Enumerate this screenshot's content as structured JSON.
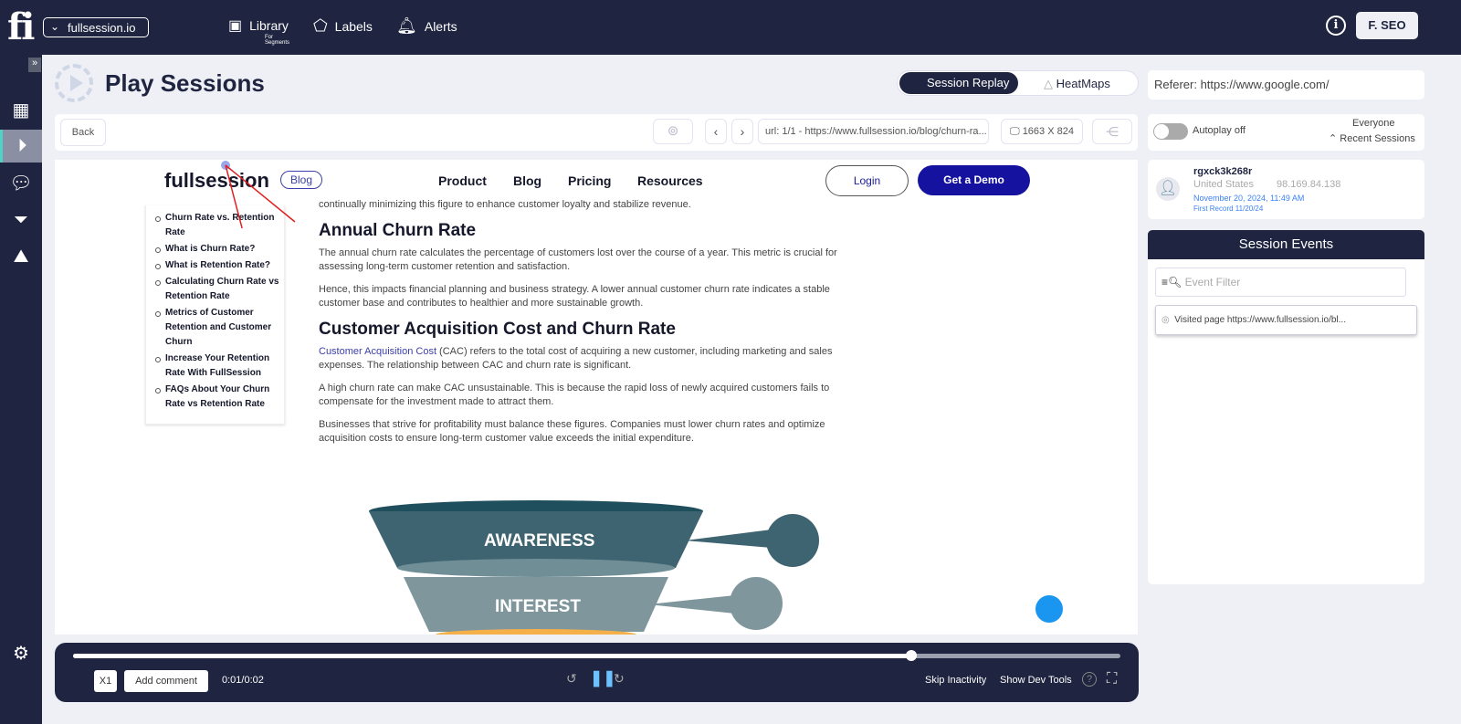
{
  "topbar": {
    "logo": "fi",
    "site": "fullsession.io",
    "nav": [
      {
        "label": "Library",
        "sub": "For Segments"
      },
      {
        "label": "Labels"
      },
      {
        "label": "Alerts"
      }
    ],
    "user": "F. SEO"
  },
  "page": {
    "title": "Play Sessions"
  },
  "modes": {
    "session_replay": "Session Replay",
    "heatmaps": "HeatMaps",
    "active": "Session Replay"
  },
  "toolbar": {
    "back": "Back",
    "url": "url: 1/1 -  https://www.fullsession.io/blog/churn-ra...",
    "resolution": "1663 X 824"
  },
  "referer": "Referer: https://www.google.com/",
  "autoplay": {
    "label": "Autoplay off",
    "on": false,
    "audience": "Everyone",
    "recent": "Recent Sessions"
  },
  "visitor": {
    "id": "rgxck3k268r",
    "country": "United States",
    "ip": "98.169.84.138",
    "date": "November 20, 2024, 11:49 AM",
    "first_record": "First Record 11/20/24"
  },
  "events": {
    "title": "Session Events",
    "filter_placeholder": "Event Filter",
    "items": [
      "Visited page https://www.fullsession.io/bl..."
    ]
  },
  "site": {
    "logo": "fullsession",
    "blog_pill": "Blog",
    "nav": [
      "Product",
      "Blog",
      "Pricing",
      "Resources"
    ],
    "login": "Login",
    "demo": "Get a Demo",
    "toc": [
      "Churn Rate vs. Retention Rate",
      "What is Churn Rate?",
      "What is Retention Rate?",
      "Calculating Churn Rate vs Retention Rate",
      "Metrics of Customer Retention and Customer Churn",
      "Increase Your Retention Rate With FullSession",
      "FAQs About Your Churn Rate vs Retention Rate"
    ],
    "intro": "continually minimizing this figure to enhance customer loyalty and stabilize revenue.",
    "h1": "Annual Churn Rate",
    "p1": "The annual churn rate calculates the percentage of customers lost over the course of a year. This metric is crucial for assessing long-term customer retention and satisfaction.",
    "p2": "Hence, this impacts financial planning and business strategy. A lower annual customer churn rate indicates a stable customer base and contributes to healthier and more sustainable growth.",
    "h2": "Customer Acquisition Cost and Churn Rate",
    "p3_link": "Customer Acquisition Cost",
    "p3": " (CAC) refers to the total cost of acquiring a new customer, including marketing and sales expenses. The relationship between CAC and churn rate is significant.",
    "p4": "A high churn rate can make CAC unsustainable. This is because the rapid loss of newly acquired customers fails to compensate for the investment made to attract them.",
    "p5": "Businesses that strive for profitability must balance these figures. Companies must lower churn rates and optimize acquisition costs to ensure long-term customer value exceeds the initial expenditure.",
    "funnel": [
      "AWARENESS",
      "INTEREST"
    ]
  },
  "player": {
    "speed": "X1",
    "add_comment": "Add comment",
    "time": "0:01/0:02",
    "progress_percent": 80,
    "skip": "Skip Inactivity",
    "devtools": "Show Dev Tools"
  }
}
